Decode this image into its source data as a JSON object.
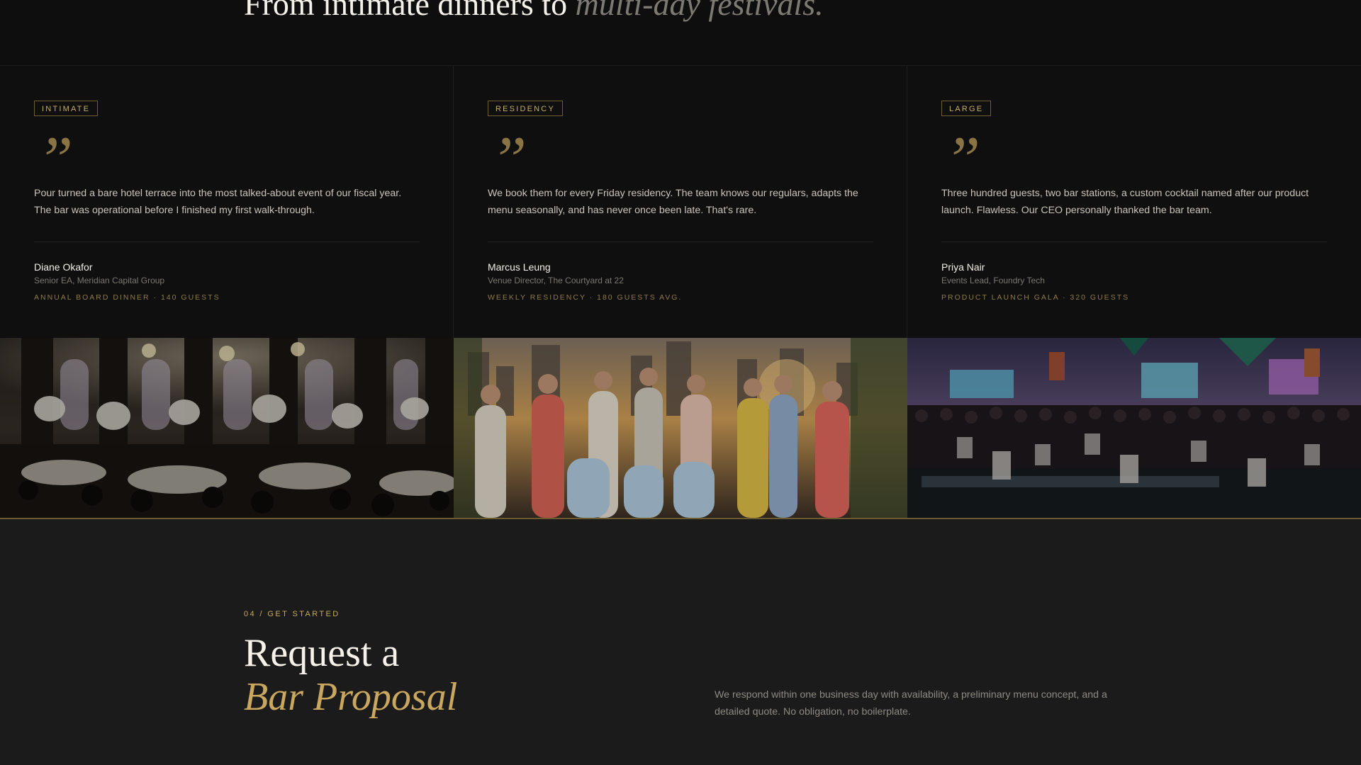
{
  "hero": {
    "title_start": "From intimate dinners to ",
    "title_accent": "multi-day festivals."
  },
  "testimonials": [
    {
      "tag": "INTIMATE",
      "quote_mark": "”",
      "quote": "Pour turned a bare hotel terrace into the most talked-about event of our fiscal year. The bar was operational before I finished my first walk-through.",
      "name": "Diane Okafor",
      "role": "Senior EA, Meridian Capital Group",
      "meta": "ANNUAL BOARD DINNER · 140 GUESTS"
    },
    {
      "tag": "RESIDENCY",
      "quote_mark": "”",
      "quote": "We book them for every Friday residency. The team knows our regulars, adapts the menu seasonally, and has never once been late. That's rare.",
      "name": "Marcus Leung",
      "role": "Venue Director, The Courtyard at 22",
      "meta": "WEEKLY RESIDENCY · 180 GUESTS AVG."
    },
    {
      "tag": "LARGE",
      "quote_mark": "”",
      "quote": "Three hundred guests, two bar stations, a custom cocktail named after our product launch. Flawless. Our CEO personally thanked the bar team.",
      "name": "Priya Nair",
      "role": "Events Lead, Foundry Tech",
      "meta": "PRODUCT LAUNCH GALA · 320 GUESTS"
    }
  ],
  "gallery": [
    {
      "icon": "ballroom-dinner-photo"
    },
    {
      "icon": "rooftop-party-photo"
    },
    {
      "icon": "festival-crowd-photo"
    }
  ],
  "cta": {
    "eyebrow": "04 / GET STARTED",
    "title_line1": "Request a",
    "title_line2": "Bar Proposal",
    "description": "We respond within one business day with availability, a preliminary menu concept, and a detailed quote. No obligation, no boilerplate."
  },
  "colors": {
    "background": "#0e0e0e",
    "gold": "#c9a75e",
    "cta_background": "#1b1b1b"
  }
}
